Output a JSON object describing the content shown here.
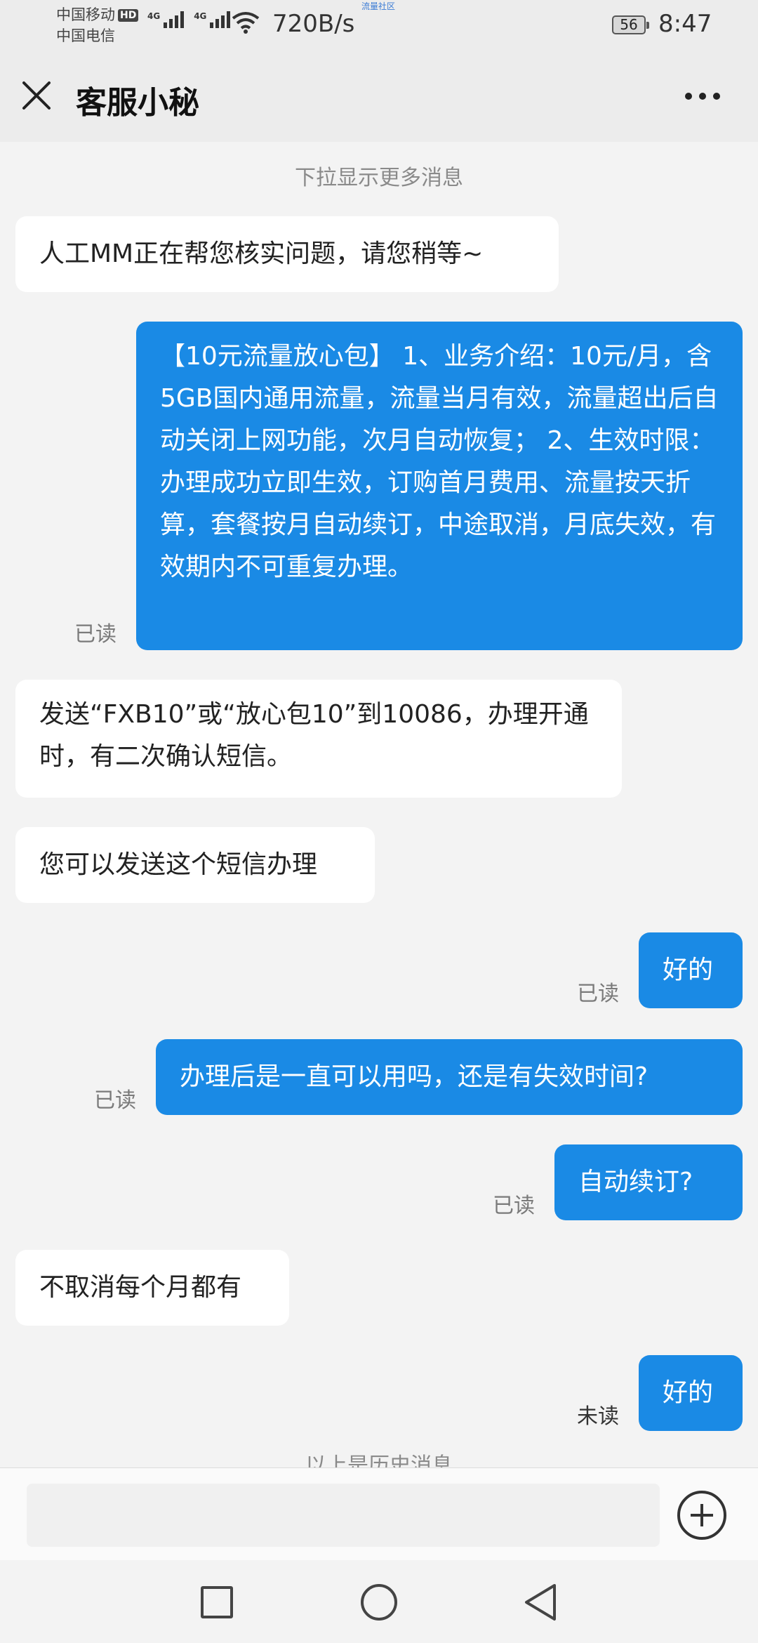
{
  "status_bar": {
    "carrier1": "中国移动",
    "hd_badge": "HD",
    "carrier2": "中国电信",
    "network1": "4G",
    "network2": "4G",
    "speed": "720B/s",
    "tiny_label": "流量社区",
    "battery": "56",
    "time": "8:47"
  },
  "header": {
    "close_icon": "close-icon",
    "title": "客服小秘",
    "more_icon": "more-dots-icon"
  },
  "chat": {
    "pull_hint": "下拉显示更多消息",
    "messages": [
      {
        "from": "agent",
        "text": "人工MM正在帮您核实问题，请您稍等~"
      },
      {
        "from": "user",
        "text": "【10元流量放心包】 1、业务介绍：10元/月，含5GB国内通用流量，流量当月有效，流量超出后自动关闭上网功能，次月自动恢复； 2、生效时限：办理成功立即生效，订购首月费用、流量按天折算，套餐按月自动续订，中途取消，月底失效，有效期内不可重复办理。",
        "status": "已读"
      },
      {
        "from": "agent",
        "text": "发送“FXB10”或“放心包10”到10086，办理开通时，有二次确认短信。"
      },
      {
        "from": "agent",
        "text": "您可以发送这个短信办理"
      },
      {
        "from": "user",
        "text": "好的",
        "status": "已读"
      },
      {
        "from": "user",
        "text": "办理后是一直可以用吗，还是有失效时间?",
        "status": "已读"
      },
      {
        "from": "user",
        "text": "自动续订?",
        "status": "已读"
      },
      {
        "from": "agent",
        "text": "不取消每个月都有"
      },
      {
        "from": "user",
        "text": "好的",
        "status": "未读"
      }
    ],
    "history_divider": "以上是历史消息"
  },
  "input_bar": {
    "placeholder": "",
    "plus_icon": "add-circle-icon"
  },
  "nav_bar": {
    "recents_icon": "square-icon",
    "home_icon": "circle-icon",
    "back_icon": "triangle-back-icon"
  },
  "colors": {
    "bubble_outgoing": "#1a8ae5",
    "bubble_incoming": "#ffffff",
    "background": "#f3f3f3"
  }
}
